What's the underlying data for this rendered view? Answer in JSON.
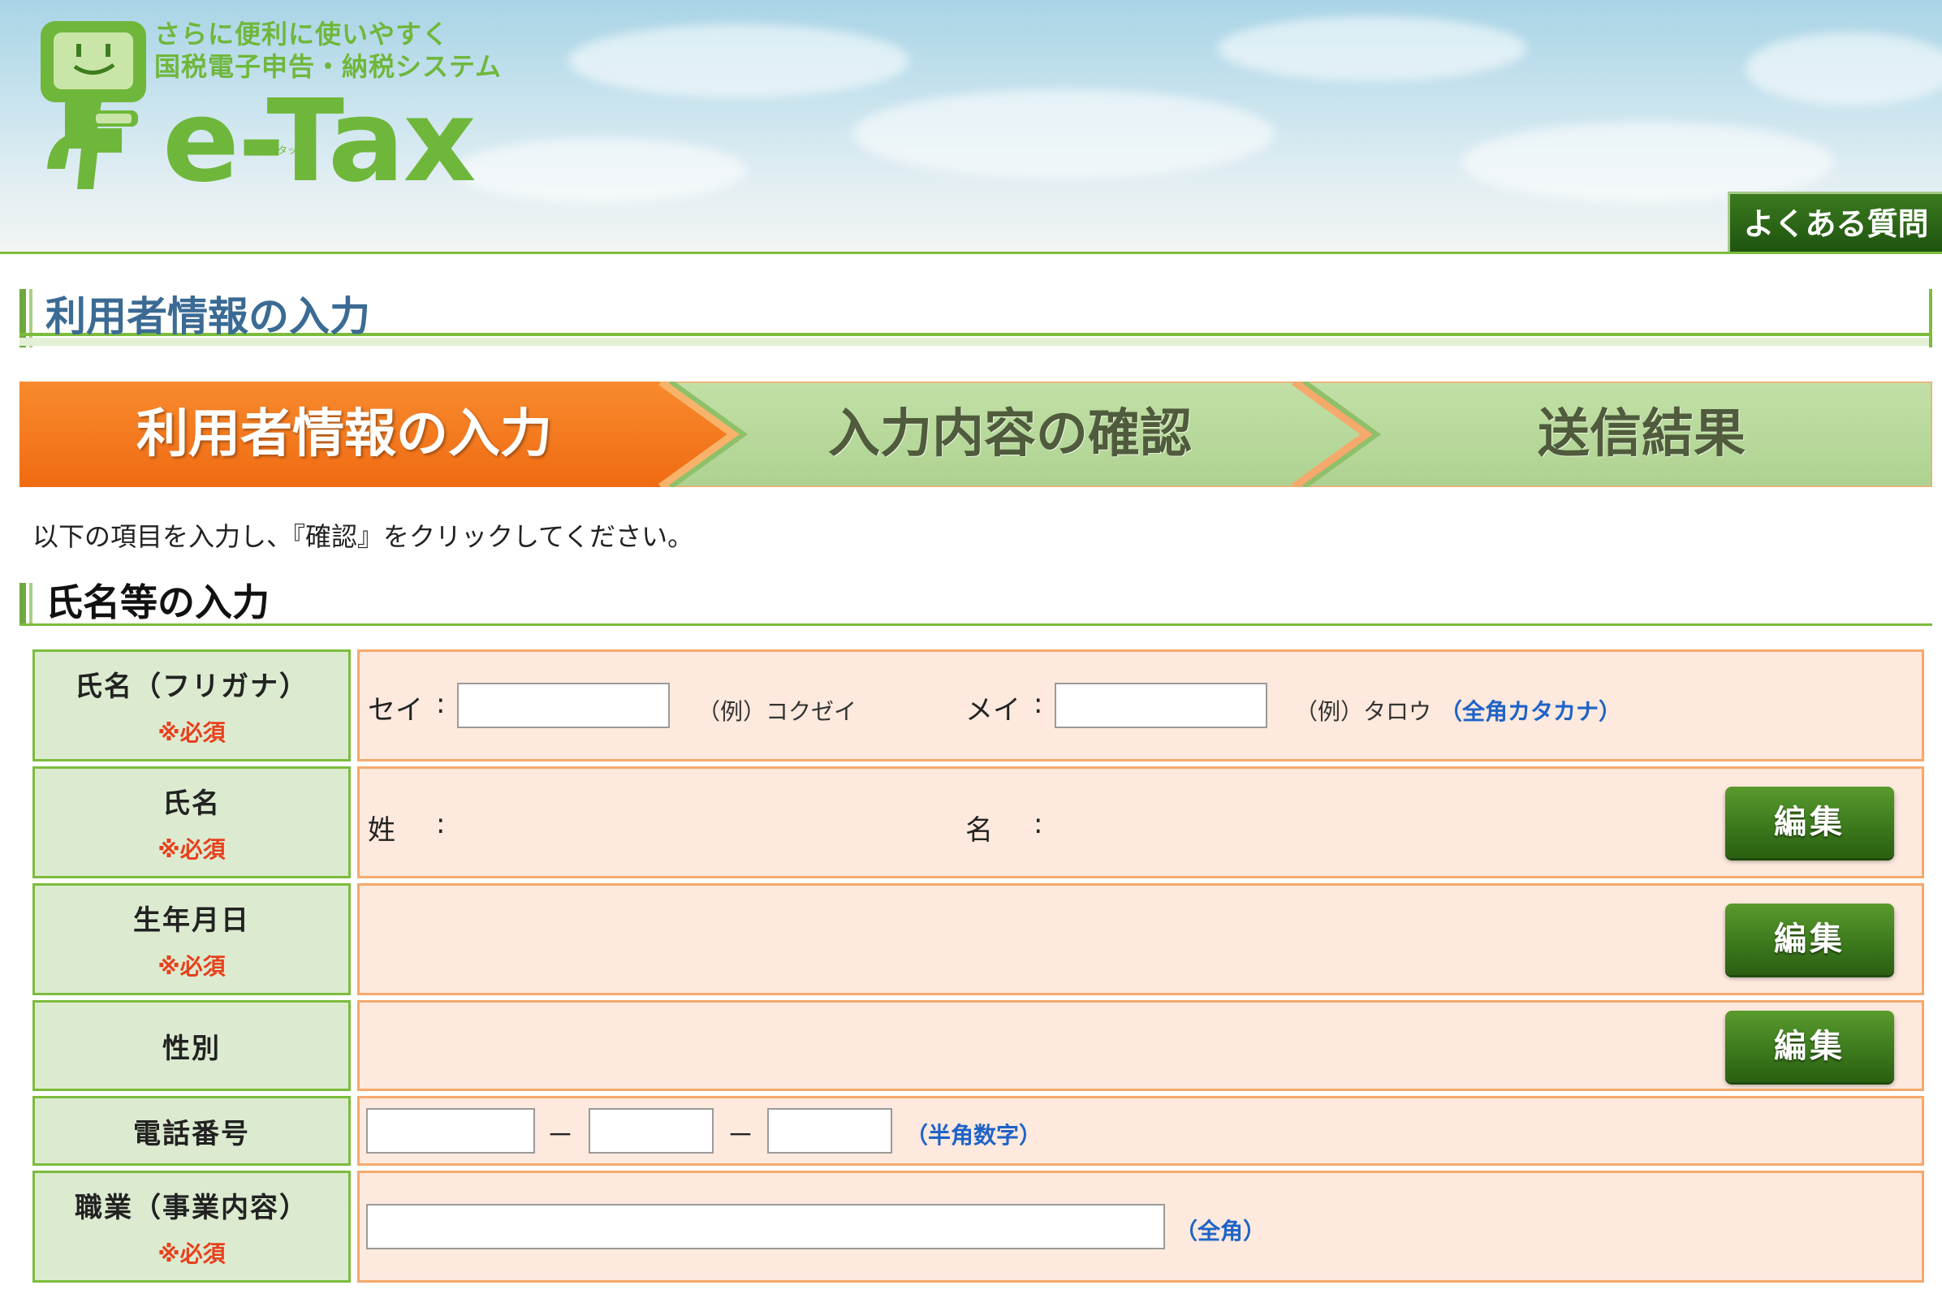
{
  "header": {
    "tagline_line1": "さらに便利に使いやすく",
    "tagline_line2": "国税電子申告・納税システム",
    "logo_text": "e-Tax",
    "logo_ruby": "イータックス",
    "faq_label": "よくある質問"
  },
  "page_title": "利用者情報の入力",
  "steps": [
    {
      "label": "利用者情報の入力",
      "state": "current"
    },
    {
      "label": "入力内容の確認",
      "state": "upcoming"
    },
    {
      "label": "送信結果",
      "state": "upcoming"
    }
  ],
  "instruction": "以下の項目を入力し、『確認』をクリックしてください。",
  "section_title": "氏名等の入力",
  "required_mark": "※必須",
  "form": {
    "furigana": {
      "label": "氏名（フリガナ）",
      "sei_label": "セイ",
      "sei_example": "（例）コクゼイ",
      "mei_label": "メイ",
      "mei_example": "（例）タロウ",
      "hint": "（全角カタカナ）",
      "sei_value": "",
      "mei_value": ""
    },
    "name": {
      "label": "氏名",
      "sei_label": "姓",
      "mei_label": "名",
      "edit_label": "編集"
    },
    "birthdate": {
      "label": "生年月日",
      "edit_label": "編集"
    },
    "gender": {
      "label": "性別",
      "edit_label": "編集"
    },
    "phone": {
      "label": "電話番号",
      "separator": "－",
      "hint": "（半角数字）",
      "part1": "",
      "part2": "",
      "part3": ""
    },
    "occupation": {
      "label": "職業（事業内容）",
      "hint": "（全角）",
      "value": ""
    }
  },
  "colors": {
    "brand_green": "#6fb73b",
    "step_current": "#f47920",
    "step_upcoming": "#b7d99a",
    "label_bg": "#dcebd0",
    "value_bg": "#fde9dd",
    "required": "#e8401c",
    "hint_blue": "#1f63c8"
  }
}
